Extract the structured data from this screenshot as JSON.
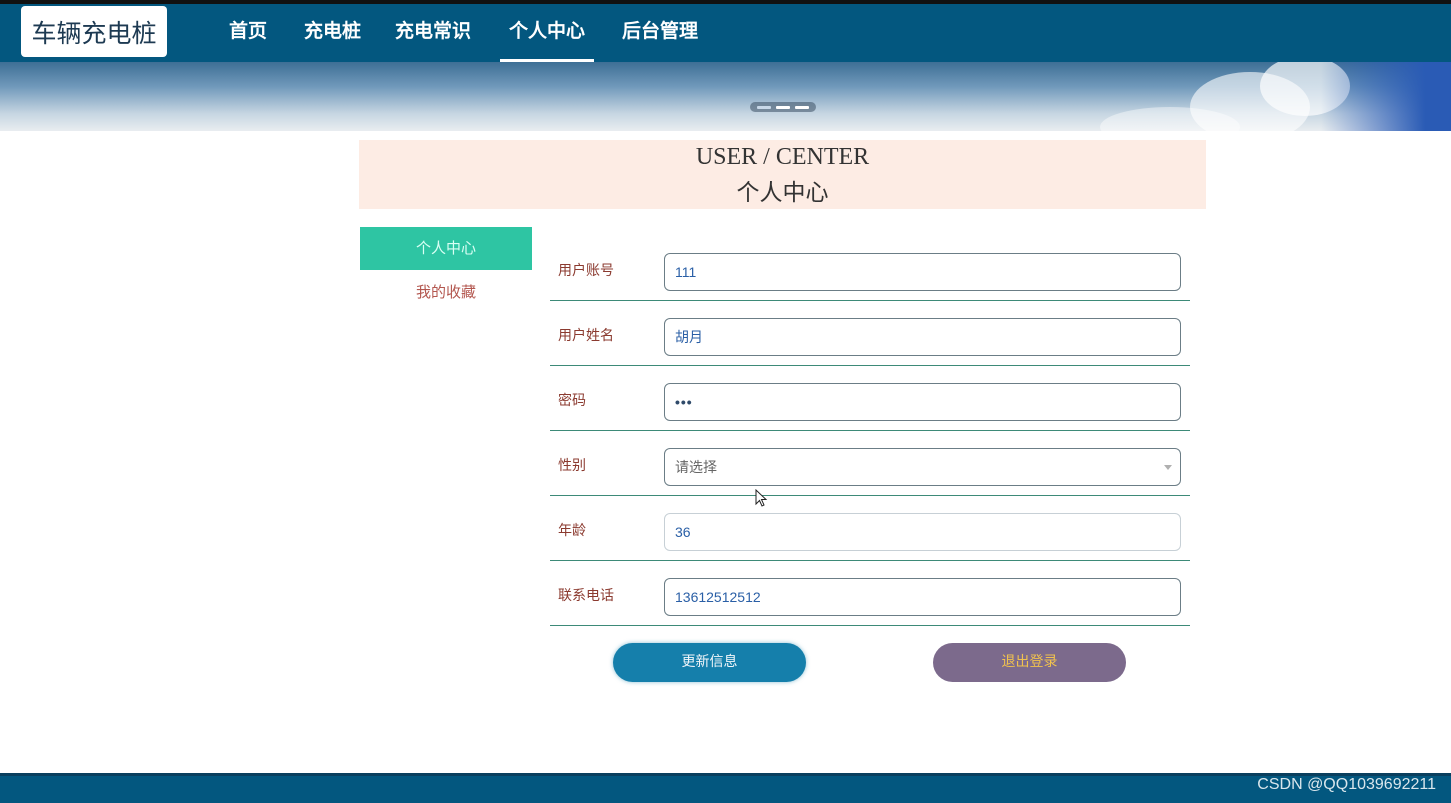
{
  "header": {
    "logo": "车辆充电桩",
    "nav": [
      {
        "label": "首页"
      },
      {
        "label": "充电桩"
      },
      {
        "label": "充电常识"
      },
      {
        "label": "个人中心"
      },
      {
        "label": "后台管理"
      }
    ],
    "active_nav": "个人中心"
  },
  "banner": {
    "carousel_indicators": 3
  },
  "section": {
    "title_en": "USER / CENTER",
    "title_cn": "个人中心"
  },
  "sidebar": {
    "items": [
      {
        "label": "个人中心"
      },
      {
        "label": "我的收藏"
      }
    ]
  },
  "form": {
    "account": {
      "label": "用户账号",
      "value": "111"
    },
    "name": {
      "label": "用户姓名",
      "value": "胡月"
    },
    "password": {
      "label": "密码",
      "value": "•••"
    },
    "gender": {
      "label": "性别",
      "placeholder": "请选择"
    },
    "age": {
      "label": "年龄",
      "value": "36"
    },
    "phone": {
      "label": "联系电话",
      "value": "13612512512"
    }
  },
  "buttons": {
    "update": "更新信息",
    "logout": "退出登录"
  },
  "watermark": "CSDN @QQ1039692211",
  "colors": {
    "navbar": "#03577f",
    "sidebar_active": "#2ec5a3",
    "update_button": "#157fab",
    "logout_button": "#7c6a8c",
    "title_bg": "#fdece4"
  }
}
